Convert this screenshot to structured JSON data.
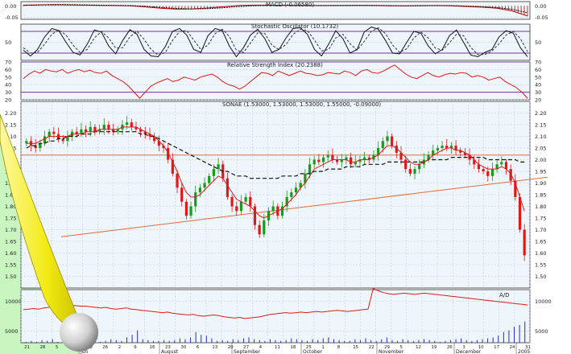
{
  "colors": {
    "panel_bg": "#eef6fb",
    "grid": "#b9c7d9",
    "frame": "#333333",
    "price_up": "#1a9a1a",
    "price_down": "#e01818",
    "ma_short": "#e01818",
    "ma_long": "#111111",
    "trendline": "#e06a3a",
    "osc_band": "#7a2fa0",
    "volume": "#2c2cc0",
    "corner_green": "#c8f5c0",
    "page_curl": "#f2ea10"
  },
  "chart_data": [
    {
      "id": "macd",
      "type": "bar",
      "title": "MACD (-0.06580)",
      "ylim": [
        -0.06,
        0.02
      ],
      "yticks": [
        "0.00",
        "-0.05"
      ],
      "series": [
        {
          "values": [
            0.004,
            0.005,
            0.006,
            0.005,
            0.004,
            0.003,
            0.002,
            0.001,
            -0.004,
            -0.01,
            -0.014,
            -0.013,
            -0.009,
            -0.004,
            0.002,
            0.004,
            0.004,
            0.003,
            0.002,
            0.002,
            0.002,
            0.003,
            0.003,
            0.002,
            0.001,
            0.001,
            0.002,
            0.002,
            0.001,
            -0.002,
            -0.005,
            -0.01,
            -0.022,
            -0.045
          ]
        },
        {
          "values": [
            0.003,
            0.005,
            0.006,
            0.006,
            0.005,
            0.004,
            0.003,
            0.002,
            -0.001,
            -0.006,
            -0.011,
            -0.013,
            -0.012,
            -0.008,
            -0.003,
            0.001,
            0.003,
            0.004,
            0.003,
            0.002,
            0.002,
            0.002,
            0.003,
            0.003,
            0.002,
            0.001,
            0.001,
            0.002,
            0.002,
            0.0,
            -0.003,
            -0.007,
            -0.015,
            -0.03
          ]
        }
      ]
    },
    {
      "id": "stochastic",
      "type": "line",
      "title": "Stochastic Oscillator (10.1732)",
      "ylim": [
        0,
        100
      ],
      "yticks": [
        "50"
      ],
      "bands": [
        20,
        80
      ],
      "series": [
        {
          "values": [
            28,
            12,
            30,
            65,
            88,
            82,
            50,
            22,
            15,
            45,
            84,
            78,
            40,
            18,
            55,
            85,
            72,
            30,
            12,
            10,
            38,
            80,
            88,
            70,
            30,
            22,
            68,
            88,
            82,
            40,
            10,
            35,
            70,
            86,
            60,
            22,
            30,
            62,
            88,
            90,
            72,
            30,
            12,
            45,
            82,
            60,
            20,
            30,
            78,
            92,
            86,
            55,
            20,
            18,
            50,
            80,
            75,
            40,
            18,
            30,
            68,
            84,
            50,
            15,
            10,
            22,
            30,
            65,
            82,
            75,
            35,
            10
          ]
        },
        {
          "values": [
            35,
            20,
            22,
            45,
            72,
            84,
            70,
            42,
            22,
            30,
            62,
            80,
            62,
            34,
            35,
            65,
            80,
            58,
            30,
            14,
            22,
            55,
            80,
            82,
            56,
            30,
            42,
            74,
            86,
            66,
            28,
            22,
            48,
            76,
            74,
            42,
            30,
            44,
            72,
            86,
            82,
            56,
            26,
            30,
            62,
            72,
            46,
            28,
            52,
            80,
            90,
            74,
            42,
            22,
            32,
            62,
            78,
            62,
            34,
            28,
            48,
            72,
            68,
            36,
            16,
            16,
            26,
            46,
            70,
            80,
            60,
            24
          ]
        }
      ]
    },
    {
      "id": "rsi",
      "type": "line",
      "title": "Relative Strength Index (20.2388)",
      "ylim": [
        20,
        70
      ],
      "yticks": [
        "70",
        "60",
        "50",
        "40",
        "30",
        "20"
      ],
      "bands": [
        30,
        70
      ],
      "series": [
        {
          "values": [
            48,
            54,
            58,
            55,
            60,
            58,
            57,
            60,
            55,
            58,
            60,
            57,
            59,
            56,
            55,
            58,
            52,
            48,
            44,
            38,
            30,
            22,
            30,
            38,
            42,
            45,
            48,
            44,
            46,
            50,
            48,
            46,
            50,
            52,
            54,
            50,
            44,
            40,
            38,
            34,
            38,
            44,
            50,
            56,
            55,
            52,
            58,
            55,
            52,
            55,
            58,
            55,
            54,
            52,
            53,
            56,
            55,
            54,
            58,
            56,
            52,
            58,
            60,
            56,
            55,
            58,
            62,
            66,
            60,
            54,
            50,
            48,
            52,
            56,
            52,
            50,
            53,
            55,
            54,
            56,
            55,
            50,
            52,
            50,
            46,
            48,
            50,
            44,
            40,
            36,
            30,
            22
          ]
        }
      ]
    },
    {
      "id": "price",
      "type": "candlestick",
      "title": "SONAE (1.53000, 1.53000, 1.53000, 1.55000, -0.09000)",
      "ylim": [
        1.45,
        2.25
      ],
      "yticks": [
        "2.20",
        "2.15",
        "2.10",
        "2.05",
        "2.00",
        "1.95",
        "1.90",
        "1.85",
        "1.80",
        "1.75",
        "1.70",
        "1.65",
        "1.60",
        "1.55",
        "1.50"
      ],
      "horizontal_line": 2.02,
      "trendline": {
        "from": [
          0,
          1.67
        ],
        "to": [
          1,
          1.925
        ]
      },
      "closes": [
        2.08,
        2.06,
        2.05,
        2.07,
        2.1,
        2.12,
        2.11,
        2.09,
        2.08,
        2.1,
        2.12,
        2.11,
        2.13,
        2.12,
        2.14,
        2.12,
        2.13,
        2.15,
        2.13,
        2.12,
        2.13,
        2.15,
        2.16,
        2.14,
        2.13,
        2.12,
        2.11,
        2.1,
        2.08,
        2.06,
        2.05,
        2.0,
        1.94,
        1.88,
        1.82,
        1.76,
        1.8,
        1.86,
        1.88,
        1.9,
        1.93,
        1.96,
        1.98,
        1.92,
        1.84,
        1.8,
        1.78,
        1.82,
        1.84,
        1.8,
        1.72,
        1.68,
        1.74,
        1.78,
        1.8,
        1.76,
        1.8,
        1.84,
        1.86,
        1.88,
        1.9,
        1.94,
        1.98,
        2.0,
        1.99,
        2.01,
        2.02,
        2.0,
        1.99,
        2.0,
        2.01,
        1.98,
        1.99,
        2.0,
        2.01,
        2.0,
        2.02,
        2.05,
        2.08,
        2.1,
        2.06,
        2.03,
        2.0,
        1.96,
        1.94,
        1.96,
        1.98,
        2.0,
        2.02,
        2.04,
        2.05,
        2.06,
        2.05,
        2.06,
        2.04,
        2.03,
        2.02,
        2.0,
        1.98,
        1.96,
        1.95,
        1.93,
        1.96,
        1.98,
        1.99,
        1.96,
        1.91,
        1.84,
        1.7,
        1.59
      ],
      "ma_short": [
        2.07,
        2.07,
        2.07,
        2.08,
        2.09,
        2.1,
        2.1,
        2.1,
        2.1,
        2.1,
        2.11,
        2.11,
        2.11,
        2.12,
        2.12,
        2.12,
        2.13,
        2.13,
        2.13,
        2.13,
        2.13,
        2.14,
        2.14,
        2.14,
        2.14,
        2.13,
        2.12,
        2.11,
        2.1,
        2.08,
        2.06,
        2.03,
        1.99,
        1.95,
        1.9,
        1.86,
        1.84,
        1.84,
        1.85,
        1.87,
        1.89,
        1.91,
        1.93,
        1.92,
        1.89,
        1.86,
        1.83,
        1.82,
        1.81,
        1.8,
        1.78,
        1.76,
        1.75,
        1.76,
        1.77,
        1.78,
        1.79,
        1.81,
        1.83,
        1.85,
        1.88,
        1.9,
        1.93,
        1.96,
        1.97,
        1.98,
        1.99,
        2.0,
        2.0,
        2.0,
        2.0,
        1.99,
        1.99,
        2.0,
        2.0,
        2.0,
        2.01,
        2.02,
        2.04,
        2.06,
        2.06,
        2.05,
        2.03,
        2.01,
        1.99,
        1.98,
        1.98,
        1.99,
        2.0,
        2.02,
        2.03,
        2.04,
        2.05,
        2.05,
        2.04,
        2.04,
        2.03,
        2.02,
        2.0,
        1.98,
        1.97,
        1.96,
        1.96,
        1.96,
        1.97,
        1.96,
        1.94,
        1.9,
        1.84,
        1.78
      ],
      "ma_long": [
        2.05,
        2.06,
        2.06,
        2.07,
        2.07,
        2.08,
        2.08,
        2.09,
        2.09,
        2.1,
        2.1,
        2.1,
        2.11,
        2.11,
        2.11,
        2.12,
        2.12,
        2.12,
        2.12,
        2.12,
        2.12,
        2.12,
        2.12,
        2.12,
        2.12,
        2.11,
        2.11,
        2.1,
        2.1,
        2.09,
        2.08,
        2.07,
        2.06,
        2.05,
        2.04,
        2.03,
        2.02,
        2.01,
        2.0,
        1.99,
        1.98,
        1.97,
        1.96,
        1.95,
        1.95,
        1.94,
        1.93,
        1.93,
        1.93,
        1.92,
        1.92,
        1.92,
        1.92,
        1.92,
        1.92,
        1.92,
        1.93,
        1.93,
        1.93,
        1.93,
        1.94,
        1.94,
        1.94,
        1.95,
        1.95,
        1.95,
        1.96,
        1.96,
        1.96,
        1.96,
        1.97,
        1.97,
        1.97,
        1.97,
        1.98,
        1.98,
        1.98,
        1.98,
        1.98,
        1.99,
        1.99,
        1.99,
        1.99,
        1.99,
        1.99,
        1.99,
        1.99,
        1.99,
        2.0,
        2.0,
        2.0,
        2.0,
        2.0,
        2.01,
        2.01,
        2.01,
        2.01,
        2.01,
        2.01,
        2.01,
        2.01,
        2.0,
        2.0,
        2.0,
        2.0,
        2.0,
        2.0,
        2.0,
        1.99,
        1.99
      ]
    },
    {
      "id": "accumulation",
      "type": "line",
      "title": "A/D",
      "ylim": [
        3000,
        12000
      ],
      "yticks": [
        "10000",
        "5000"
      ],
      "series": [
        {
          "values": [
            8600,
            8700,
            8800,
            8700,
            8900,
            9000,
            9100,
            9000,
            9200,
            9100,
            9300,
            9200,
            9200,
            9100,
            9000,
            8900,
            9000,
            8800,
            8700,
            8800,
            8900,
            8700,
            8600,
            8500,
            8400,
            8300,
            8200,
            8100,
            8200,
            8000,
            7900,
            7800,
            7700,
            7800,
            7600,
            7500,
            7600,
            7700,
            7600,
            7400,
            7300,
            7200,
            7300,
            7100,
            7200,
            7300,
            7400,
            7600,
            7800,
            7900,
            8000,
            8100,
            8000,
            8100,
            8200,
            8100,
            8200,
            8300,
            8200,
            8300,
            8400,
            8500,
            8400,
            8300,
            8400,
            8500,
            8600,
            8700,
            12200,
            11800,
            11500,
            11300,
            11200,
            11300,
            11400,
            11300,
            11200,
            11300,
            11400,
            11300,
            11200,
            11100,
            11000,
            10900,
            10800,
            10700,
            10600,
            10500,
            10400,
            10300,
            10200,
            10100,
            10000,
            9900,
            9800,
            9700,
            9600,
            9500,
            9400
          ]
        }
      ]
    }
  ],
  "axis": {
    "months": [
      "Jun",
      "August",
      "September",
      "October",
      "November",
      "December",
      "2005"
    ],
    "days": [
      "21",
      "28",
      "5",
      "12",
      "19",
      "26",
      "2",
      "9",
      "16",
      "23",
      "30",
      "6",
      "13",
      "20",
      "27",
      "4",
      "11",
      "18",
      "25",
      "1",
      "8",
      "15",
      "22",
      "29",
      "5",
      "12",
      "19",
      "26",
      "3",
      "10",
      "17",
      "24",
      "31"
    ],
    "volume": [
      1,
      2,
      1,
      3,
      2,
      4,
      1,
      2,
      3,
      2,
      1,
      5,
      3,
      2,
      1,
      2,
      4,
      3,
      2,
      6,
      9,
      14,
      4,
      3,
      2,
      2,
      3,
      2,
      3,
      5,
      4,
      6,
      12,
      9,
      8,
      5,
      2,
      3,
      2,
      4,
      3,
      5,
      6,
      4,
      3,
      2,
      4,
      3,
      2,
      3,
      5,
      4,
      3,
      2,
      4,
      3,
      5,
      6,
      4,
      3,
      2,
      2,
      4,
      3,
      5,
      3,
      2,
      4,
      6,
      3,
      2,
      4,
      3,
      2,
      3,
      4,
      3,
      2,
      1,
      2,
      3,
      4,
      5,
      3,
      2,
      3,
      4,
      5,
      6,
      8,
      12,
      14,
      18,
      20,
      24
    ]
  }
}
